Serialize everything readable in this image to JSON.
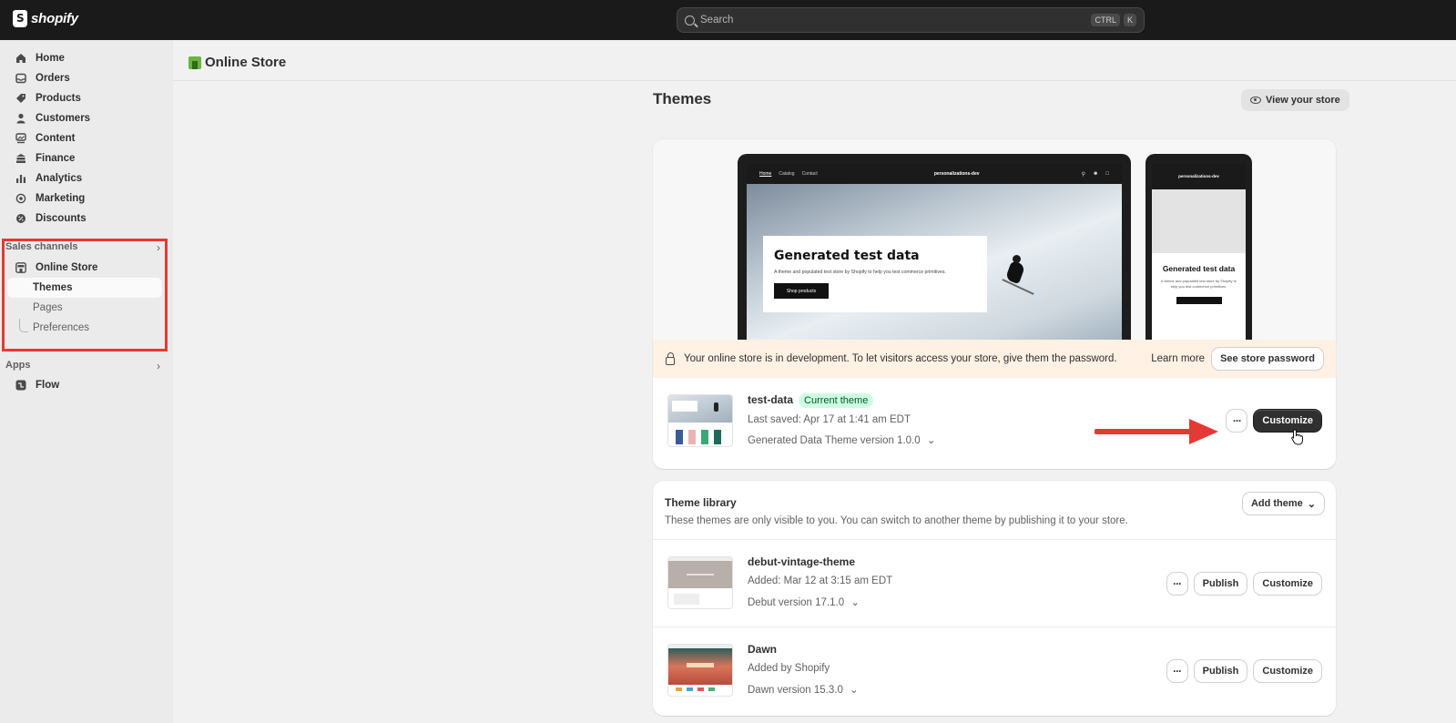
{
  "topbar": {
    "brand": "shopify",
    "search_placeholder": "Search",
    "shortcut_ctrl": "CTRL",
    "shortcut_key": "K"
  },
  "sidebar": {
    "items": [
      {
        "label": "Home",
        "icon": "home-icon"
      },
      {
        "label": "Orders",
        "icon": "inbox-icon"
      },
      {
        "label": "Products",
        "icon": "tag-icon"
      },
      {
        "label": "Customers",
        "icon": "person-icon"
      },
      {
        "label": "Content",
        "icon": "image-icon"
      },
      {
        "label": "Finance",
        "icon": "bank-icon"
      },
      {
        "label": "Analytics",
        "icon": "bar-chart-icon"
      },
      {
        "label": "Marketing",
        "icon": "target-icon"
      },
      {
        "label": "Discounts",
        "icon": "discount-icon"
      }
    ],
    "sales_channels_label": "Sales channels",
    "online_store_label": "Online Store",
    "sub_items": [
      "Themes",
      "Pages",
      "Preferences"
    ],
    "apps_label": "Apps",
    "flow_label": "Flow"
  },
  "page": {
    "header_title": "Online Store",
    "themes_title": "Themes",
    "view_store_label": "View your store"
  },
  "preview": {
    "nav_links": [
      "Home",
      "Catalog",
      "Contact"
    ],
    "store_name": "personalizations-dev",
    "hero_title": "Generated test data",
    "hero_sub": "A theme and populated test store by Shopify to help you test commerce primitives.",
    "hero_button": "Shop products",
    "mobile_title": "Generated test data",
    "mobile_sub": "A theme and populated test store by Shopify to help you test commerce primitives."
  },
  "banner": {
    "text": "Your online store is in development. To let visitors access your store, give them the password.",
    "learn_more": "Learn more",
    "button": "See store password"
  },
  "current_theme": {
    "name": "test-data",
    "badge": "Current theme",
    "last_saved": "Last saved: Apr 17 at 1:41 am EDT",
    "version": "Generated Data Theme version 1.0.0",
    "customize_label": "Customize",
    "more_label": "···"
  },
  "library": {
    "title": "Theme library",
    "subtitle": "These themes are only visible to you. You can switch to another theme by publishing it to your store.",
    "add_theme_label": "Add theme",
    "themes": [
      {
        "name": "debut-vintage-theme",
        "meta": "Added: Mar 12 at 3:15 am EDT",
        "version": "Debut version 17.1.0",
        "publish_label": "Publish",
        "customize_label": "Customize",
        "more_label": "···"
      },
      {
        "name": "Dawn",
        "meta": "Added by Shopify",
        "version": "Dawn version 15.3.0",
        "publish_label": "Publish",
        "customize_label": "Customize",
        "more_label": "···"
      }
    ]
  },
  "colors": {
    "topbar": "#1a1a1a",
    "highlight": "#e53935",
    "badge_bg": "#cdfee1",
    "banner_bg": "#fff1e3"
  }
}
